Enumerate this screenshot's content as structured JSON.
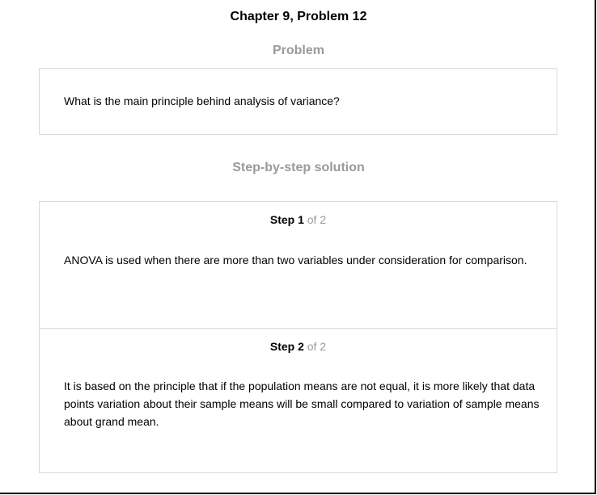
{
  "page": {
    "title": "Chapter 9, Problem 12"
  },
  "problem": {
    "heading": "Problem",
    "text": "What is the main principle behind analysis of variance?"
  },
  "solution": {
    "heading": "Step-by-step solution",
    "steps": [
      {
        "label": "Step 1",
        "of": "of 2",
        "text": "ANOVA is used when there are more than two variables under consideration for comparison."
      },
      {
        "label": "Step 2",
        "of": "of 2",
        "text": "It is based on the principle that if the population means are not equal, it is more likely that data points variation about their sample means will be small compared to variation of sample means about grand mean."
      }
    ]
  }
}
